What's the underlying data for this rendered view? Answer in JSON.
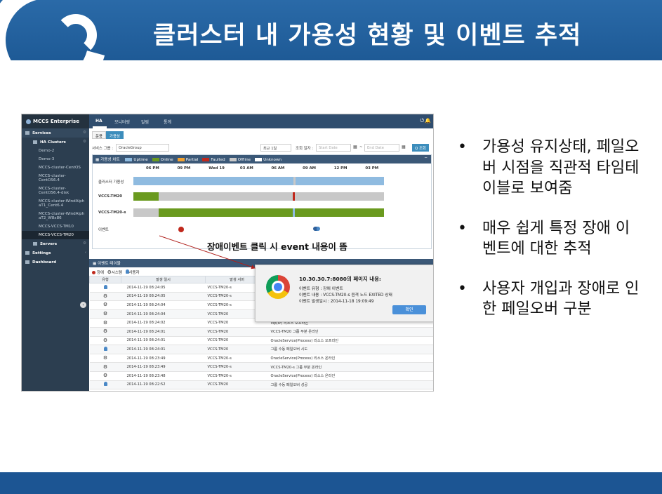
{
  "slide": {
    "title": "클러스터 내 가용성 현황 및 이벤트 추적",
    "bullets": [
      "가용성 유지상태, 페일오버 시점을 직관적 타임테이블로 보여줌",
      "매우 쉽게 특정 장애 이벤트에 대한 추적",
      "사용자 개입과 장애로 인한 페일오버 구분"
    ],
    "bullet_symbol": "•",
    "annotation": "장애이벤트 클릭 시 event 내용이 뜸",
    "colors": {
      "title_bar": "#2267a6",
      "footer_bar": "#1c5593",
      "annotation_arrow": "#b0201c"
    }
  },
  "app": {
    "brand": "MCCS Enterprise",
    "sidebar": {
      "sections": [
        {
          "label": "Services",
          "icon": "grid-icon"
        },
        {
          "label": "HA Clusters",
          "icon": "folder-icon"
        }
      ],
      "clusters": [
        "Demo-2",
        "Demo-3",
        "MCCS-cluster-CentOS",
        "MCCS-cluster-CentOS6.4",
        "MCCS-cluster-CentOS6.4-disk",
        "MCCS-cluster-WindAlphaT1_Cent6.4",
        "MCCS-cluster-WindAlphaT2_W8x86",
        "MCCS-VCCS-TM10",
        "MCCS-VCCS-TM20"
      ],
      "servers": "Servers",
      "settings": "Settings",
      "dashboard": "Dashboard",
      "active": "MCCS-VCCS-TM20"
    },
    "nav": {
      "tabs": [
        "HA",
        "모니터링",
        "알림",
        "통계"
      ],
      "active": "HA",
      "power_icon": "power-icon",
      "bell_icon": "bell-icon"
    },
    "sub_tabs": [
      "운용",
      "가용성"
    ],
    "active_sub_tab": "가용성",
    "filter": {
      "service_group_label": "서비스 그룹 :",
      "service_group_value": "OracleGroup",
      "period_value": "최근 1일",
      "date_label": "조회 일자 :",
      "start_placeholder": "Start Date",
      "separator": "~",
      "end_placeholder": "End Date",
      "search_button": "Q 조회"
    },
    "chart_panel": {
      "title": "가용성 차트",
      "minimize": "−",
      "legend": [
        {
          "label": "Uptime",
          "color": "#8fbbe0"
        },
        {
          "label": "Online",
          "color": "#6a9a1f"
        },
        {
          "label": "Partial",
          "color": "#f0a030"
        },
        {
          "label": "Faulted",
          "color": "#c0281c"
        },
        {
          "label": "Offline",
          "color": "#c8c8c8"
        },
        {
          "label": "Unknown",
          "color": "#ffffff"
        }
      ]
    },
    "event_panel": {
      "title": "이벤트 테이블",
      "types": [
        {
          "label": "장애",
          "color": "#c0281c"
        },
        {
          "label": "시스템",
          "color": "#333333"
        },
        {
          "label": "사용자",
          "color": "#4a88c6"
        }
      ],
      "columns": [
        "유형",
        "발생 일시",
        "발생 서버",
        ""
      ],
      "rows": [
        {
          "type": "user",
          "time": "2014-11-19 08:24:05",
          "server": "VCCS-TM20-s",
          "message": ""
        },
        {
          "type": "system",
          "time": "2014-11-19 08:24:05",
          "server": "VCCS-TM20-s",
          "message": ""
        },
        {
          "type": "system",
          "time": "2014-11-19 08:24:04",
          "server": "VCCS-TM20-s",
          "message": ""
        },
        {
          "type": "system",
          "time": "2014-11-19 08:24:04",
          "server": "VCCS-TM20",
          "message": ""
        },
        {
          "type": "system",
          "time": "2014-11-19 08:24:02",
          "server": "VCCS-TM20",
          "message": "Vip(IP) 리소스 오프라인"
        },
        {
          "type": "system",
          "time": "2014-11-19 08:24:01",
          "server": "VCCS-TM20",
          "message": "VCCS-TM20 그룹 부분 온라인"
        },
        {
          "type": "system",
          "time": "2014-11-19 08:24:01",
          "server": "VCCS-TM20",
          "message": "OracleService(Process) 리소스 오프라인"
        },
        {
          "type": "user",
          "time": "2014-11-19 08:24:01",
          "server": "VCCS-TM20",
          "message": "그룹 수동 페일오버 시도"
        },
        {
          "type": "system",
          "time": "2014-11-19 08:23:49",
          "server": "VCCS-TM20-s",
          "message": "OracleService(Process) 리소스 온라인"
        },
        {
          "type": "system",
          "time": "2014-11-19 08:23:49",
          "server": "VCCS-TM20-s",
          "message": "VCCS-TM20-s 그룹 부분 온라인"
        },
        {
          "type": "system",
          "time": "2014-11-19 08:23:48",
          "server": "VCCS-TM20-s",
          "message": "OracleService(Process) 리소스 온라인"
        },
        {
          "type": "user",
          "time": "2014-11-19 08:22:52",
          "server": "VCCS-TM20",
          "message": "그룹 수동 페일오버 성공"
        }
      ]
    },
    "alert": {
      "title": "10.30.30.7:8080의 페이지 내용:",
      "lines": [
        "이벤트 유형 : 장애 이벤트",
        "이벤트 내용 : VCCS-TM20-s 원격 노드 EXITED 상태",
        "이벤트 발생일시 : 2014-11-18 19:09:49"
      ],
      "ok_button": "확인",
      "icon": "chrome-icon"
    }
  },
  "chart_data": {
    "type": "timeline",
    "ticks": [
      "06 PM",
      "09 PM",
      "Wed 19",
      "03 AM",
      "06 AM",
      "09 AM",
      "12 PM",
      "03 PM"
    ],
    "rows": [
      {
        "label": "클러스터 가용성",
        "segments": [
          {
            "state": "Uptime",
            "start": 0.0,
            "end": 0.64
          },
          {
            "state": "Offline",
            "start": 0.64,
            "end": 0.648
          },
          {
            "state": "Uptime",
            "start": 0.648,
            "end": 1.0
          }
        ]
      },
      {
        "label": "VCCS-TM20",
        "segments": [
          {
            "state": "Online",
            "start": 0.0,
            "end": 0.1
          },
          {
            "state": "Offline",
            "start": 0.1,
            "end": 0.636
          },
          {
            "state": "Faulted",
            "start": 0.636,
            "end": 0.643
          },
          {
            "state": "Offline",
            "start": 0.643,
            "end": 1.0
          }
        ]
      },
      {
        "label": "VCCS-TM20-s",
        "segments": [
          {
            "state": "Offline",
            "start": 0.0,
            "end": 0.1
          },
          {
            "state": "Online",
            "start": 0.1,
            "end": 0.636
          },
          {
            "state": "Uptime",
            "start": 0.636,
            "end": 0.645
          },
          {
            "state": "Online",
            "start": 0.645,
            "end": 1.0
          }
        ]
      },
      {
        "label": "이벤트",
        "events": [
          {
            "kind": "fault",
            "at": 0.1
          },
          {
            "kind": "user",
            "at": 0.64
          }
        ]
      }
    ]
  }
}
